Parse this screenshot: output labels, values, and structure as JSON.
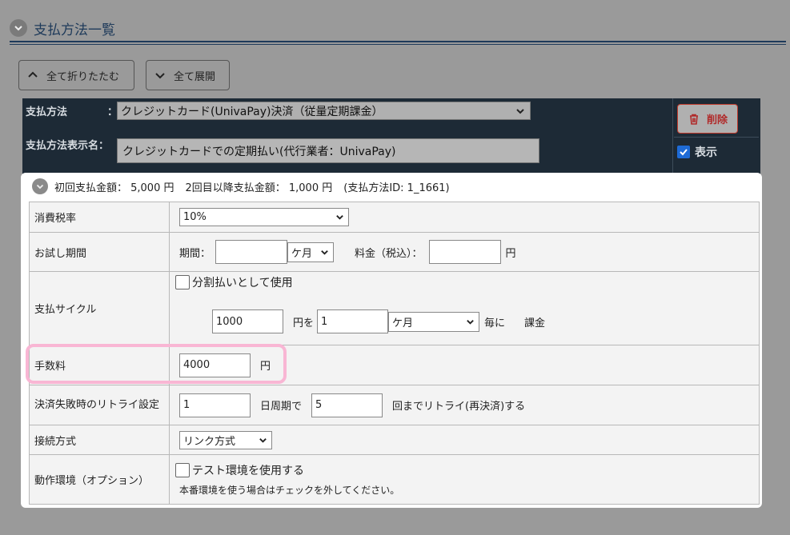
{
  "header": {
    "title": "支払方法一覧"
  },
  "toolbar": {
    "collapse_all": "全て折りたたむ",
    "expand_all": "全て展開"
  },
  "payment": {
    "method_label": "支払方法",
    "method_colon": "：",
    "method_value": "クレジットカード(UnivaPay)決済（従量定期課金）",
    "display_name_label": "支払方法表示名：",
    "display_name_value": "クレジットカードでの定期払い(代行業者：UnivaPay)",
    "delete_label": "削除",
    "show_label": "表示",
    "show_checked": true
  },
  "summary": {
    "first": "初回支払金額： 5,000 円",
    "second": "2回目以降支払金額： 1,000 円",
    "id": "(支払方法ID: 1_1661)"
  },
  "form": {
    "tax": {
      "label": "消費税率",
      "value": "10%"
    },
    "trial": {
      "label": "お試し期間",
      "period_label": "期間：",
      "period_value": "",
      "unit": "ケ月",
      "fee_label": "料金（税込）：",
      "fee_value": "",
      "yen": "円"
    },
    "cycle": {
      "label": "支払サイクル",
      "installment_label": "分割払いとして使用",
      "installment_checked": false,
      "amount": "1000",
      "yen_wo": "円を",
      "every": "1",
      "unit": "ケ月",
      "per": "毎に",
      "charge": "課金"
    },
    "fee": {
      "label": "手数料",
      "value": "4000",
      "yen": "円"
    },
    "retry": {
      "label": "決済失敗時のリトライ設定",
      "days": "1",
      "day_cycle": "日周期で",
      "times": "5",
      "suffix": "回までリトライ(再決済)する"
    },
    "connection": {
      "label": "接続方式",
      "value": "リンク方式"
    },
    "env": {
      "label": "動作環境（オプション）",
      "test_label": "テスト環境を使用する",
      "test_checked": false,
      "note": "本番環境を使う場合はチェックを外してください。"
    }
  },
  "colors": {
    "highlight": "#f9b6d4",
    "header_text": "#1e3a5a",
    "dark_panel": "#1d2a36",
    "delete": "#b02a2a"
  }
}
